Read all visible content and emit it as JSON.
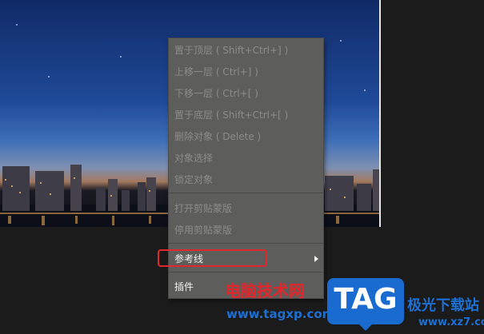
{
  "context_menu": {
    "items": [
      {
        "label": "置于顶层 ( Shift+Ctrl+] )",
        "enabled": false
      },
      {
        "label": "上移一层 ( Ctrl+] )",
        "enabled": false
      },
      {
        "label": "下移一层 ( Ctrl+[ )",
        "enabled": false
      },
      {
        "label": "置于底层 ( Shift+Ctrl+[ )",
        "enabled": false
      },
      {
        "label": "删除对象 ( Delete )",
        "enabled": false
      },
      {
        "label": "对象选择",
        "enabled": false
      },
      {
        "label": "锁定对象",
        "enabled": false
      },
      {
        "label": "打开剪贴蒙版",
        "enabled": false
      },
      {
        "label": "停用剪贴蒙版",
        "enabled": false
      },
      {
        "label": "参考线",
        "enabled": true,
        "has_submenu": true
      },
      {
        "label": "插件",
        "enabled": true
      }
    ]
  },
  "watermark": {
    "site_name": "电脑技术网",
    "site_url": "www.tagxp.com",
    "badge": "TAG",
    "right_name": "极光下载站",
    "right_url": "www.xz7.com"
  },
  "colors": {
    "menu_bg": "#5d5e5c",
    "disabled_text": "#8c8c8a",
    "enabled_text": "#f2f2f2",
    "highlight": "#e0272b",
    "watermark_red": "#e3262b",
    "watermark_blue": "#1a6bd0"
  }
}
